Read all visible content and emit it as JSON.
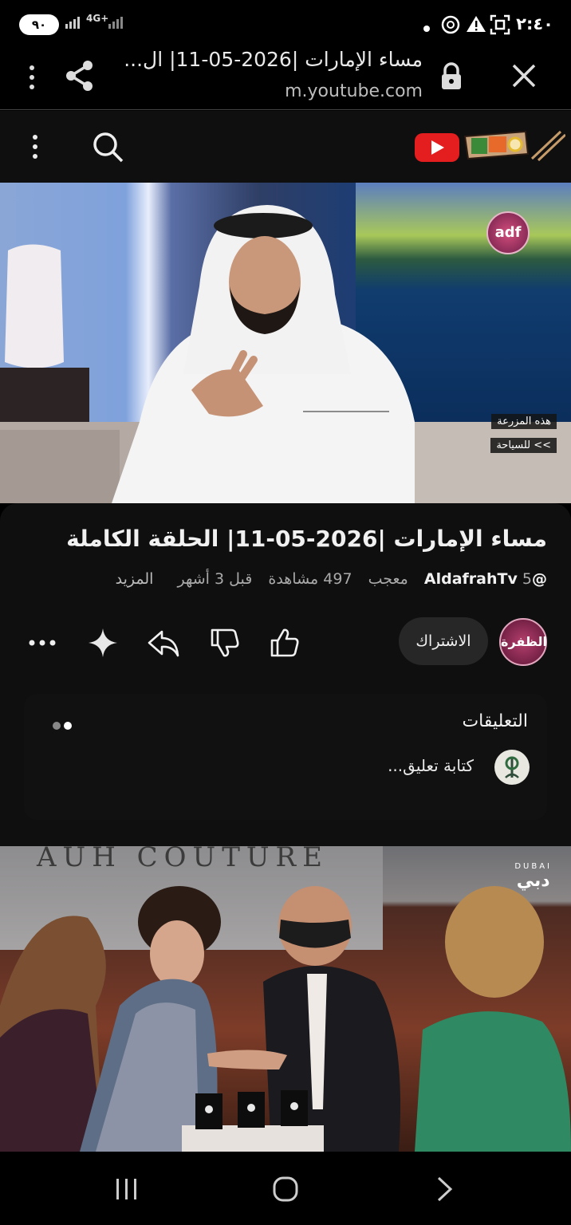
{
  "status_bar": {
    "time": "٢:٤٠",
    "battery": "٩٠",
    "network_type": "4G+",
    "icons": [
      "battery-icon",
      "signal-icon",
      "data-arrows-icon",
      "dot-icon",
      "ai-icon",
      "warning-icon",
      "scan-icon"
    ]
  },
  "browser": {
    "page_title": "مساء الإمارات |2026-05-11| ال...",
    "domain": "m.youtube.com",
    "icons": [
      "close-icon",
      "lock-icon",
      "share-icon",
      "more-vert-icon"
    ]
  },
  "yt_header": {
    "icons": [
      "youtube-logo-icon",
      "lunchbox-doodle-icon",
      "search-icon",
      "more-vert-icon"
    ]
  },
  "player": {
    "channel_bug": "adf",
    "chyron_line1": "هذه المزرعة",
    "chyron_line2": ">> للسياحة"
  },
  "video": {
    "title": "مساء الإمارات |2026-05-11| الحلقة الكاملة",
    "handle": "@AldafrahTv",
    "likes": "5 معجب",
    "views": "497 مشاهدة",
    "age": "قبل 3 أشهر",
    "more": "المزيد"
  },
  "channel": {
    "logo_text": "الظفرة",
    "subscribe_label": "الاشتراك"
  },
  "actions": {
    "icons": [
      "like-icon",
      "dislike-icon",
      "share-icon",
      "ask-sparkle-icon",
      "more-horiz-icon"
    ]
  },
  "comments": {
    "title": "التعليقات",
    "placeholder": "كتابة تعليق..."
  },
  "next_video": {
    "backdrop_text": "AUH COUTURE",
    "channel_bug_top": "DUBAI",
    "channel_bug_main": "دبي"
  },
  "nav": {
    "icons": [
      "recents-icon",
      "home-icon",
      "back-icon"
    ]
  },
  "colors": {
    "background": "#0f0f0f",
    "youtube_red": "#ff0000",
    "subscribe_bg": "#272727",
    "secondary_text": "#aaaaaa"
  }
}
